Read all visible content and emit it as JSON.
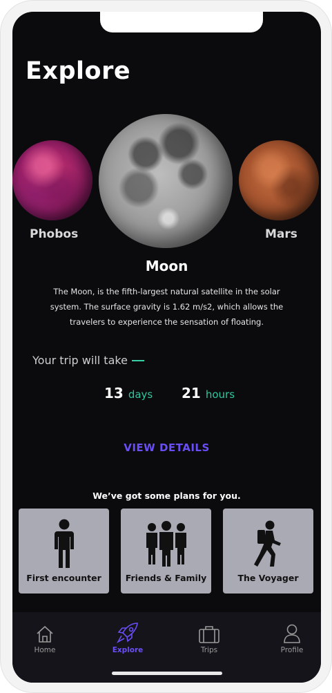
{
  "header": {
    "title": "Explore"
  },
  "planets": {
    "left": "Phobos",
    "center": "Moon",
    "right": "Mars"
  },
  "selected": {
    "name": "Moon",
    "description": "The Moon, is the fifth-largest natural satellite in the solar system. The surface gravity is 1.62 m/s2, which allows the travelers to experience the sensation of floating."
  },
  "trip": {
    "label": "Your trip will take",
    "days_value": "13",
    "days_unit": "days",
    "hours_value": "21",
    "hours_unit": "hours"
  },
  "cta": {
    "view_details": "VIEW DETAILS"
  },
  "plans": {
    "heading": "We’ve got some plans for you.",
    "items": [
      {
        "label": "First encounter",
        "icon": "single-person-icon"
      },
      {
        "label": "Friends & Family",
        "icon": "group-people-icon"
      },
      {
        "label": "The Voyager",
        "icon": "hiker-backpack-icon"
      }
    ]
  },
  "tabbar": {
    "items": [
      {
        "label": "Home",
        "icon": "house-icon",
        "active": false
      },
      {
        "label": "Explore",
        "icon": "rocket-icon",
        "active": true
      },
      {
        "label": "Trips",
        "icon": "suitcase-icon",
        "active": false
      },
      {
        "label": "Profile",
        "icon": "person-icon",
        "active": false
      }
    ]
  },
  "colors": {
    "background": "#0b0b0e",
    "accent_purple": "#6a4ef5",
    "accent_green": "#2fc89e",
    "card": "#a9aab4",
    "tabbar": "#14141a"
  }
}
